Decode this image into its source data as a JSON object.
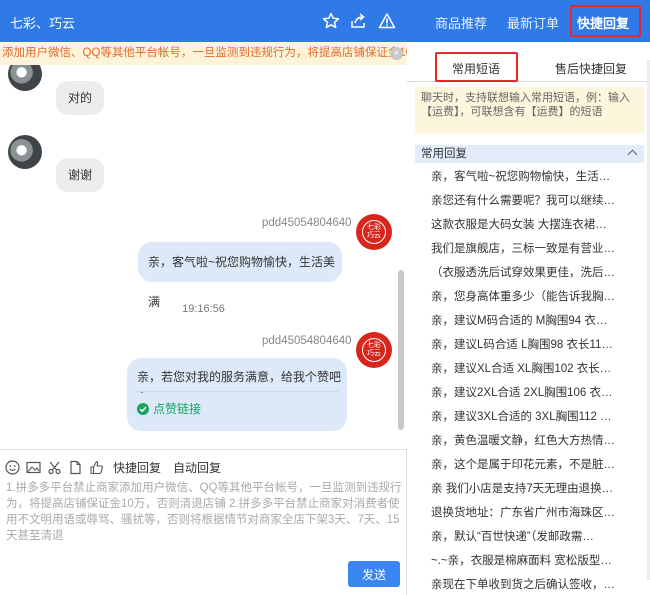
{
  "header": {
    "title": "七彩、巧云"
  },
  "warning": {
    "text": "添加用户微信、QQ等其他平台帐号，一旦监测到违规行为，将提高店铺保证金10万，"
  },
  "chat": {
    "messages_in": [
      "对的",
      "谢谢"
    ],
    "out1": {
      "sender": "pdd45054804640",
      "text": "亲，客气啦~祝您购物愉快，生活美满"
    },
    "timestamp": "19:16:56",
    "out2": {
      "sender": "pdd45054804640",
      "text": "亲，若您对我的服务满意，给我个赞吧~",
      "link": "点赞链接"
    },
    "shop_badge": [
      "七彩",
      "巧云"
    ]
  },
  "compose": {
    "quick_reply": "快捷回复",
    "auto_reply": "自动回复",
    "draft": "1.拼多多平台禁止商家添加用户微信、QQ等其他平台帐号，一旦监测到违规行为，将提高店铺保证金10万，否则清退店铺 2.拼多多平台禁止商家对消费者使用不文明用语或辱骂、骚扰等，否则将根据情节对商家全店下架3天、7天、15天甚至清退",
    "send": "发送"
  },
  "right": {
    "tabs": [
      "商品推荐",
      "最新订单",
      "快捷回复"
    ],
    "subtabs": [
      "常用短语",
      "售后快捷回复"
    ],
    "hint": "聊天时，支持联想输入常用短语，例：输入【运费】，可联想含有【运费】的短语",
    "group": "常用回复",
    "phrases": [
      "亲，客气啦~祝您购物愉快，生活…",
      "亲您还有什么需要呢？我可以继续…",
      "这款衣服是大码女装 大摆连衣裙…",
      "我们是旗舰店，三标一致是有营业…",
      "（衣服透洗后试穿效果更佳，洗后…",
      "亲，您身高体重多少（能告诉我胸…",
      "亲，建议M码合适的 M胸围94 衣…",
      "亲，建议L码合适 L胸围98 衣长11…",
      "亲，建议XL合适 XL胸围102 衣长…",
      "亲，建议2XL合适 2XL胸围106 衣…",
      "亲，建议3XL合适的 3XL胸围112 …",
      "亲，黄色温暖文静，红色大方热情…",
      "亲，这个是属于印花元素，不是脏…",
      "亲 我们小店是支持7天无理由退换…",
      "退换货地址：广东省广州市海珠区…",
      "亲，默认“百世快递”（发邮政需…",
      "~.~亲，衣服是棉麻面料 宽松版型…",
      "亲现在下单收到货之后确认签收，…"
    ]
  },
  "colors": {
    "accent": "#2f7ae6",
    "highlight": "#e8262b",
    "send": "#3b85f0",
    "warning_text": "#e06b2f"
  }
}
